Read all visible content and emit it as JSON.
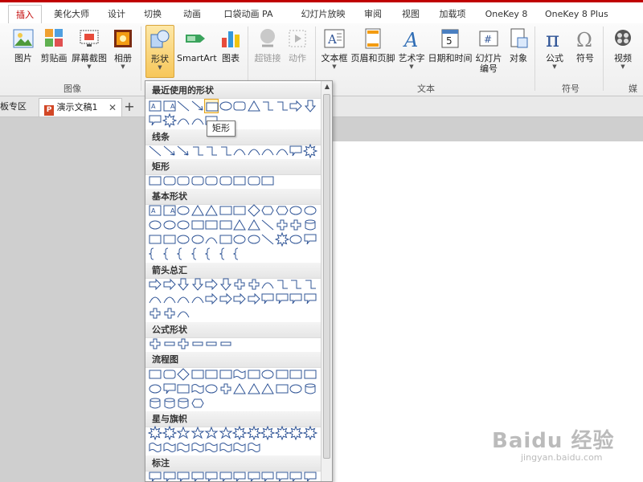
{
  "ribbon_tabs": [
    "插入",
    "美化大师",
    "设计",
    "切换",
    "动画",
    "口袋动画 PA",
    "幻灯片放映",
    "审阅",
    "视图",
    "加载项",
    "OneKey 8",
    "OneKey 8 Plus"
  ],
  "active_tab": "插入",
  "groups": {
    "image": {
      "label": "图像",
      "buttons": [
        {
          "label": "图片",
          "icon": "picture-icon"
        },
        {
          "label": "剪贴画",
          "icon": "clipart-icon"
        },
        {
          "label": "屏幕截图",
          "icon": "screenshot-icon",
          "has_menu": true
        },
        {
          "label": "相册",
          "icon": "photo-album-icon",
          "has_menu": true
        }
      ]
    },
    "illustrations": {
      "buttons": [
        {
          "label": "形状",
          "icon": "shapes-icon",
          "has_menu": true,
          "pressed": true
        },
        {
          "label": "SmartArt",
          "icon": "smartart-icon"
        },
        {
          "label": "图表",
          "icon": "chart-icon"
        }
      ]
    },
    "links": {
      "buttons": [
        {
          "label": "超链接",
          "icon": "hyperlink-icon",
          "disabled": true
        },
        {
          "label": "动作",
          "icon": "action-icon",
          "disabled": true
        }
      ]
    },
    "text": {
      "label": "文本",
      "buttons": [
        {
          "label": "文本框",
          "icon": "textbox-icon",
          "has_menu": true
        },
        {
          "label": "页眉和页脚",
          "icon": "header-footer-icon"
        },
        {
          "label": "艺术字",
          "icon": "wordart-icon",
          "has_menu": true
        },
        {
          "label": "日期和时间",
          "icon": "date-time-icon"
        },
        {
          "label": "幻灯片\n编号",
          "label_line1": "幻灯片",
          "label_line2": "编号",
          "icon": "slide-number-icon"
        },
        {
          "label": "对象",
          "icon": "object-icon"
        }
      ]
    },
    "symbols": {
      "label": "符号",
      "buttons": [
        {
          "label": "公式",
          "icon": "equation-icon",
          "has_menu": true
        },
        {
          "label": "符号",
          "icon": "symbol-icon"
        }
      ]
    },
    "media": {
      "label": "媒",
      "buttons": [
        {
          "label": "视频",
          "icon": "video-icon",
          "has_menu": true
        }
      ]
    }
  },
  "document_tabs": [
    {
      "label": "模板专区",
      "visible_text": "板专区"
    },
    {
      "label": "演示文稿1",
      "active": true
    }
  ],
  "doc_tab_close": "✕",
  "doc_tab_add": "+",
  "gallery": {
    "sections": [
      {
        "title": "最近使用的形状"
      },
      {
        "title": "线条"
      },
      {
        "title": "矩形"
      },
      {
        "title": "基本形状"
      },
      {
        "title": "箭头总汇"
      },
      {
        "title": "公式形状"
      },
      {
        "title": "流程图"
      },
      {
        "title": "星与旗帜"
      },
      {
        "title": "标注"
      }
    ],
    "hovered_shape": "rectangle"
  },
  "tooltip": "矩形",
  "watermark": {
    "logo": "Baidu 经验",
    "url": "jingyan.baidu.com"
  },
  "colors": {
    "accent_red": "#c00000",
    "pressed_gold": "#f7c75a",
    "shape_stroke": "#2f5496"
  }
}
